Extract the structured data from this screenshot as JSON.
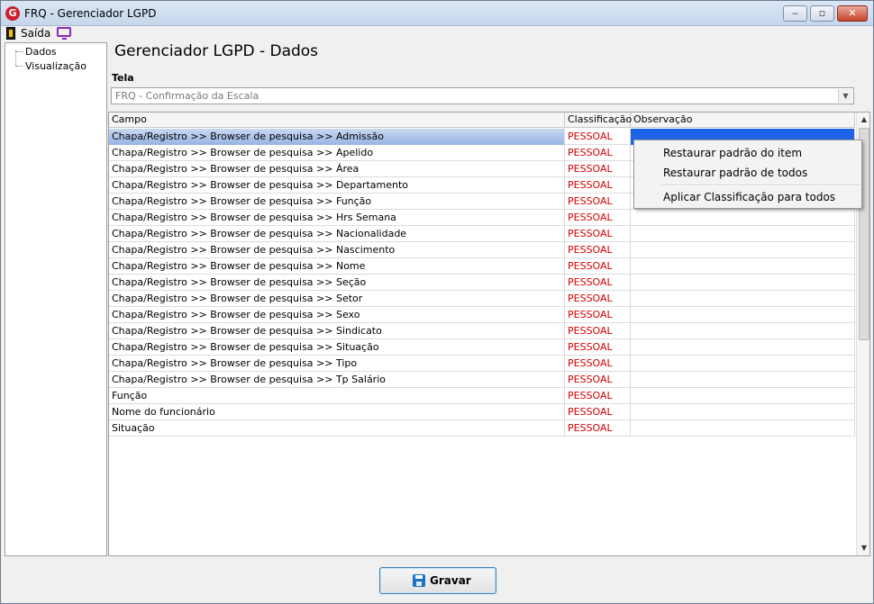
{
  "window": {
    "title": "FRQ - Gerenciador LGPD",
    "minimize": "‒",
    "maximize": "▫",
    "close": "✕"
  },
  "menu": {
    "exit": "Saída"
  },
  "tree": {
    "items": [
      "Dados",
      "Visualização"
    ]
  },
  "page": {
    "title": "Gerenciador LGPD - Dados"
  },
  "tela": {
    "label": "Tela",
    "value": "FRQ - Confirmação da Escala"
  },
  "grid": {
    "headers": [
      "Campo",
      "Classificação",
      "Observação"
    ],
    "rows": [
      {
        "campo": "Chapa/Registro >> Browser de pesquisa >> Admissão",
        "classificacao": "PESSOAL",
        "observacao": ""
      },
      {
        "campo": "Chapa/Registro >> Browser de pesquisa >> Apelido",
        "classificacao": "PESSOAL",
        "observacao": ""
      },
      {
        "campo": "Chapa/Registro >> Browser de pesquisa >> Área",
        "classificacao": "PESSOAL",
        "observacao": ""
      },
      {
        "campo": "Chapa/Registro >> Browser de pesquisa >> Departamento",
        "classificacao": "PESSOAL",
        "observacao": ""
      },
      {
        "campo": "Chapa/Registro >> Browser de pesquisa >> Função",
        "classificacao": "PESSOAL",
        "observacao": ""
      },
      {
        "campo": "Chapa/Registro >> Browser de pesquisa >> Hrs Semana",
        "classificacao": "PESSOAL",
        "observacao": ""
      },
      {
        "campo": "Chapa/Registro >> Browser de pesquisa >> Nacionalidade",
        "classificacao": "PESSOAL",
        "observacao": ""
      },
      {
        "campo": "Chapa/Registro >> Browser de pesquisa >> Nascimento",
        "classificacao": "PESSOAL",
        "observacao": ""
      },
      {
        "campo": "Chapa/Registro >> Browser de pesquisa >> Nome",
        "classificacao": "PESSOAL",
        "observacao": ""
      },
      {
        "campo": "Chapa/Registro >> Browser de pesquisa >> Seção",
        "classificacao": "PESSOAL",
        "observacao": ""
      },
      {
        "campo": "Chapa/Registro >> Browser de pesquisa >> Setor",
        "classificacao": "PESSOAL",
        "observacao": ""
      },
      {
        "campo": "Chapa/Registro >> Browser de pesquisa >> Sexo",
        "classificacao": "PESSOAL",
        "observacao": ""
      },
      {
        "campo": "Chapa/Registro >> Browser de pesquisa >> Sindicato",
        "classificacao": "PESSOAL",
        "observacao": ""
      },
      {
        "campo": "Chapa/Registro >> Browser de pesquisa >> Situação",
        "classificacao": "PESSOAL",
        "observacao": ""
      },
      {
        "campo": "Chapa/Registro >> Browser de pesquisa >> Tipo",
        "classificacao": "PESSOAL",
        "observacao": ""
      },
      {
        "campo": "Chapa/Registro >> Browser de pesquisa >> Tp Salário",
        "classificacao": "PESSOAL",
        "observacao": ""
      },
      {
        "campo": "Função",
        "classificacao": "PESSOAL",
        "observacao": ""
      },
      {
        "campo": "Nome do funcionário",
        "classificacao": "PESSOAL",
        "observacao": ""
      },
      {
        "campo": "Situação",
        "classificacao": "PESSOAL",
        "observacao": ""
      }
    ]
  },
  "context_menu": {
    "items": [
      "Restaurar padrão do item",
      "Restaurar padrão de todos",
      "Aplicar Classificação para todos"
    ]
  },
  "footer": {
    "save_label": "Gravar"
  },
  "colors": {
    "classification": "#d40000",
    "selection": "#1c63e8"
  }
}
